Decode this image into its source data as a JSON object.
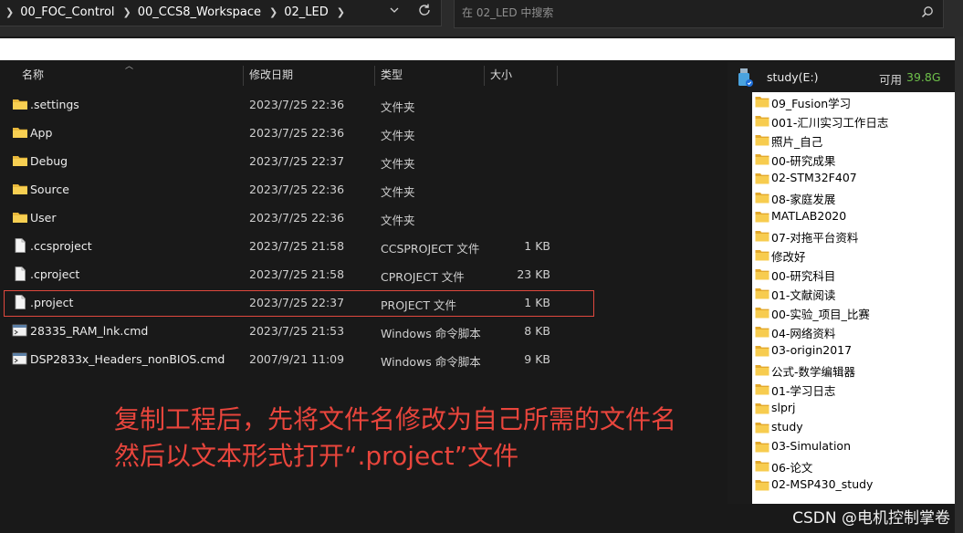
{
  "address_bar": {
    "crumbs": [
      "00_FOC_Control",
      "00_CCS8_Workspace",
      "02_LED"
    ],
    "dropdown_glyph": "⌄",
    "refresh_glyph": "↻"
  },
  "search": {
    "placeholder": "在 02_LED 中搜索"
  },
  "columns": {
    "name": "名称",
    "date": "修改日期",
    "type": "类型",
    "size": "大小"
  },
  "files": [
    {
      "icon": "folder-icon",
      "name": ".settings",
      "date": "2023/7/25 22:36",
      "type": "文件夹",
      "size": ""
    },
    {
      "icon": "folder-icon",
      "name": "App",
      "date": "2023/7/25 22:36",
      "type": "文件夹",
      "size": ""
    },
    {
      "icon": "folder-icon",
      "name": "Debug",
      "date": "2023/7/25 22:37",
      "type": "文件夹",
      "size": ""
    },
    {
      "icon": "folder-icon",
      "name": "Source",
      "date": "2023/7/25 22:36",
      "type": "文件夹",
      "size": ""
    },
    {
      "icon": "folder-icon",
      "name": "User",
      "date": "2023/7/25 22:36",
      "type": "文件夹",
      "size": ""
    },
    {
      "icon": "file-icon",
      "name": ".ccsproject",
      "date": "2023/7/25 21:58",
      "type": "CCSPROJECT 文件",
      "size": "1 KB"
    },
    {
      "icon": "file-icon",
      "name": ".cproject",
      "date": "2023/7/25 21:58",
      "type": "CPROJECT 文件",
      "size": "23 KB"
    },
    {
      "icon": "file-icon",
      "name": ".project",
      "date": "2023/7/25 22:37",
      "type": "PROJECT 文件",
      "size": "1 KB"
    },
    {
      "icon": "cmd-script-icon",
      "name": "28335_RAM_lnk.cmd",
      "date": "2023/7/25 21:53",
      "type": "Windows 命令脚本",
      "size": "8 KB"
    },
    {
      "icon": "cmd-script-icon",
      "name": "DSP2833x_Headers_nonBIOS.cmd",
      "date": "2007/9/21 11:09",
      "type": "Windows 命令脚本",
      "size": "9 KB"
    }
  ],
  "annotation": {
    "line1": "复制工程后，先将文件名修改为自己所需的文件名",
    "line2": "然后以文本形式打开“.project”文件",
    "color": "#e8453c"
  },
  "drive": {
    "name": "study(E:)",
    "free_label": "可用",
    "free_value": "39.8G",
    "free_color": "#6ec04a"
  },
  "folders": [
    "09_Fusion学习",
    "001-汇川实习工作日志",
    "照片_自己",
    "00-研究成果",
    "02-STM32F407",
    "08-家庭发展",
    "MATLAB2020",
    "07-对拖平台资料",
    "修改好",
    "00-研究科目",
    "01-文献阅读",
    "00-实验_项目_比赛",
    "04-网络资料",
    "03-origin2017",
    "公式-数学编辑器",
    "01-学习日志",
    "slprj",
    "study",
    "03-Simulation",
    "06-论文",
    "02-MSP430_study"
  ],
  "watermark": "CSDN @电机控制掌卷"
}
